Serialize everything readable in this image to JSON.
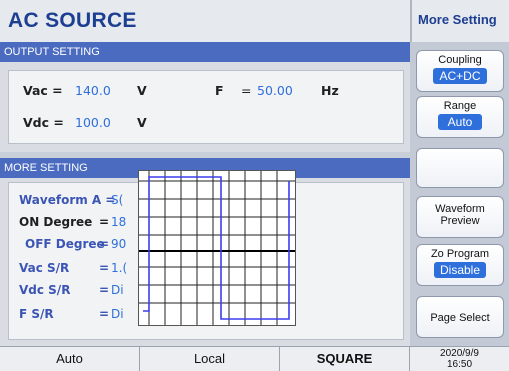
{
  "app": {
    "title": "AC SOURCE",
    "right_title": "More Setting"
  },
  "output": {
    "header": "OUTPUT SETTING",
    "vac_label": "Vac =",
    "vac_value": "140.0",
    "vac_unit": "V",
    "f_label": "F",
    "f_eq": "=",
    "f_value": "50.00",
    "f_unit": "Hz",
    "vdc_label": "Vdc =",
    "vdc_value": "100.0",
    "vdc_unit": "V"
  },
  "more": {
    "header": "MORE SETTING",
    "rows": [
      {
        "label": "Waveform A =",
        "value": "S("
      },
      {
        "label": "ON Degree",
        "eq": "=",
        "value": "18"
      },
      {
        "label": "OFF Degree",
        "eq": "=",
        "value": "90"
      },
      {
        "label": "Vac S/R",
        "eq": "=",
        "value": "1.("
      },
      {
        "label": "Vdc S/R",
        "eq": "=",
        "value": "Di"
      },
      {
        "label": "F S/R",
        "eq": "=",
        "value": "Di"
      }
    ]
  },
  "side": {
    "coupling_label": "Coupling",
    "coupling_value": "AC+DC",
    "range_label": "Range",
    "range_value": "Auto",
    "waveform_preview_line1": "Waveform",
    "waveform_preview_line2": "Preview",
    "zo_label": "Zo Program",
    "zo_value": "Disable",
    "page_select": "Page Select"
  },
  "status": {
    "mode": "Auto",
    "control": "Local",
    "waveform": "SQUARE",
    "date": "2020/9/9",
    "time": "16:50"
  }
}
